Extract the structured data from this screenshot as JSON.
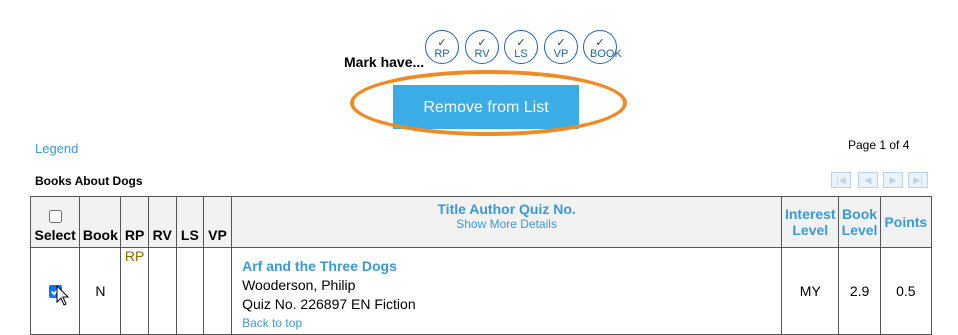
{
  "mark_have": {
    "label": "Mark have...",
    "buttons": [
      "RP",
      "RV",
      "LS",
      "VP",
      "BOOK"
    ],
    "check_glyph": "✓"
  },
  "remove_button": "Remove from List",
  "legend_link": "Legend",
  "page_info": "Page 1 of 4",
  "section_title": "Books About Dogs",
  "pager": {
    "first": "|◀",
    "prev": "◀",
    "next": "▶",
    "last": "▶|"
  },
  "table": {
    "headers": {
      "select": "Select",
      "book": "Book",
      "rp": "RP",
      "rv": "RV",
      "ls": "LS",
      "vp": "VP",
      "title": "Title  Author  Quiz No.",
      "more_details": "Show More Details",
      "interest_level": "Interest Level",
      "book_level": "Book Level",
      "points": "Points"
    },
    "rows": [
      {
        "selected": true,
        "book": "N",
        "rp": "RP",
        "rv": "",
        "ls": "",
        "vp": "",
        "title": "Arf and the Three Dogs",
        "author": "Wooderson, Philip",
        "quiz": "Quiz No. 226897 EN Fiction",
        "back_to_top": "Back to top",
        "interest_level": "MY",
        "book_level": "2.9",
        "points": "0.5"
      }
    ]
  },
  "colors": {
    "accent": "#3aace6",
    "link": "#3a9ad9",
    "highlight": "#f08a24"
  }
}
